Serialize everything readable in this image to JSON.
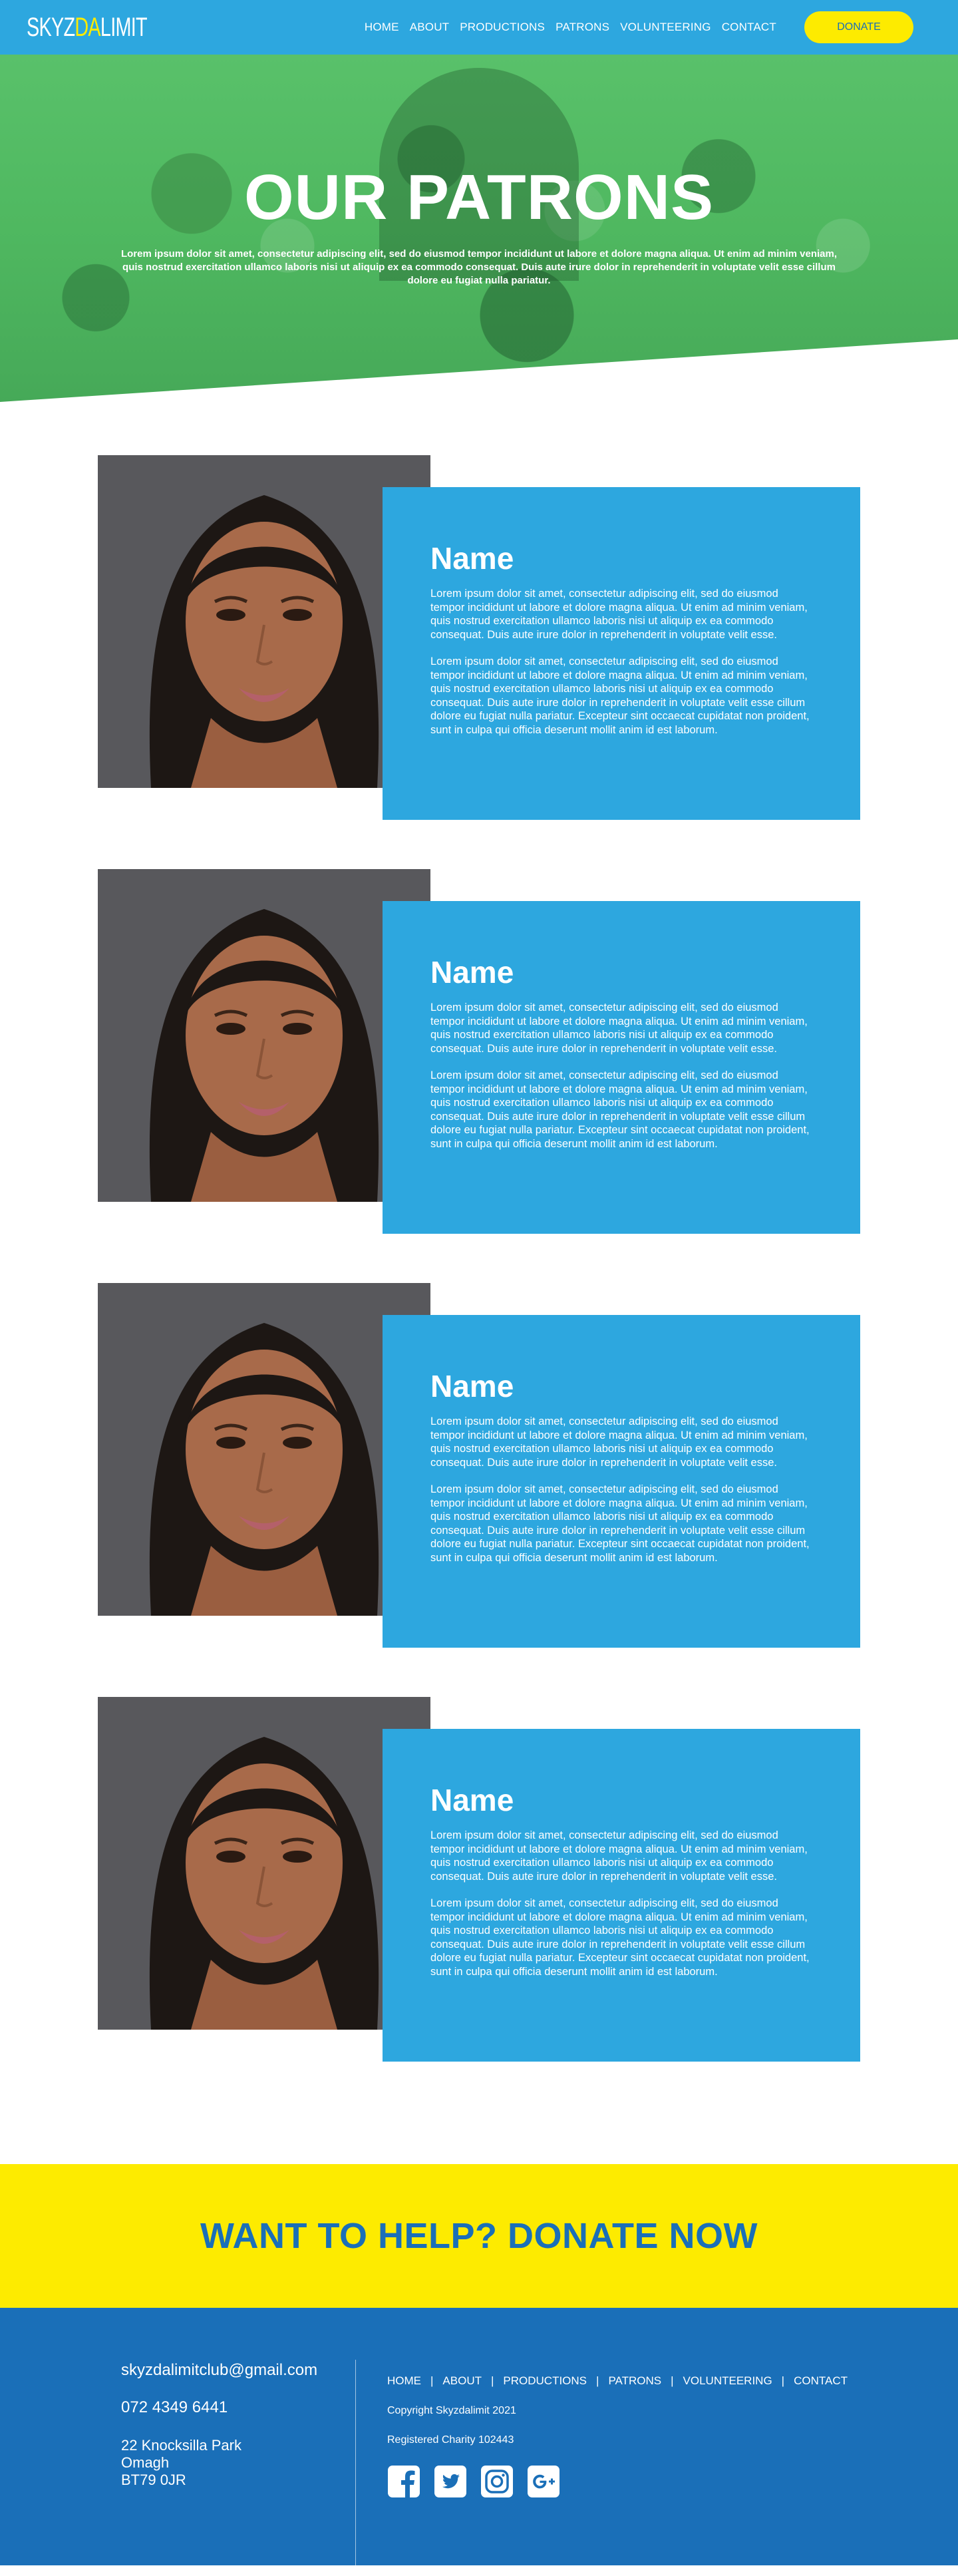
{
  "brand": {
    "logo_white": "SKYZ",
    "logo_yellow": "DA",
    "logo_white2": "LIMIT"
  },
  "nav": {
    "links": [
      "HOME",
      "ABOUT",
      "PRODUCTIONS",
      "PATRONS",
      "VOLUNTEERING",
      "CONTACT"
    ],
    "donate_label": "DONATE"
  },
  "hero": {
    "title": "OUR PATRONS",
    "text": "Lorem ipsum dolor sit amet, consectetur adipiscing elit, sed do eiusmod tempor incididunt ut labore et dolore magna aliqua. Ut enim ad minim veniam, quis nostrud exercitation ullamco laboris nisi ut aliquip ex ea commodo consequat. Duis aute irure dolor in reprehenderit in voluptate velit esse cillum dolore eu fugiat nulla pariatur."
  },
  "patrons": [
    {
      "name": "Name",
      "p1": "Lorem ipsum dolor sit amet, consectetur adipiscing elit, sed do eiusmod tempor incididunt ut labore et dolore magna aliqua. Ut enim ad minim veniam, quis nostrud exercitation ullamco laboris nisi ut aliquip ex ea commodo consequat. Duis aute irure dolor in reprehenderit in voluptate velit esse.",
      "p2": "Lorem ipsum dolor sit amet, consectetur adipiscing elit, sed do eiusmod tempor incididunt ut labore et dolore magna aliqua. Ut enim ad minim veniam, quis nostrud exercitation ullamco laboris nisi ut aliquip ex ea commodo consequat. Duis aute irure dolor in reprehenderit in voluptate velit esse cillum dolore eu fugiat nulla pariatur. Excepteur sint occaecat cupidatat non proident, sunt in culpa qui officia deserunt mollit anim id est laborum."
    },
    {
      "name": "Name",
      "p1": "Lorem ipsum dolor sit amet, consectetur adipiscing elit, sed do eiusmod tempor incididunt ut labore et dolore magna aliqua. Ut enim ad minim veniam, quis nostrud exercitation ullamco laboris nisi ut aliquip ex ea commodo consequat. Duis aute irure dolor in reprehenderit in voluptate velit esse.",
      "p2": "Lorem ipsum dolor sit amet, consectetur adipiscing elit, sed do eiusmod tempor incididunt ut labore et dolore magna aliqua. Ut enim ad minim veniam, quis nostrud exercitation ullamco laboris nisi ut aliquip ex ea commodo consequat. Duis aute irure dolor in reprehenderit in voluptate velit esse cillum dolore eu fugiat nulla pariatur. Excepteur sint occaecat cupidatat non proident, sunt in culpa qui officia deserunt mollit anim id est laborum."
    },
    {
      "name": "Name",
      "p1": "Lorem ipsum dolor sit amet, consectetur adipiscing elit, sed do eiusmod tempor incididunt ut labore et dolore magna aliqua. Ut enim ad minim veniam, quis nostrud exercitation ullamco laboris nisi ut aliquip ex ea commodo consequat. Duis aute irure dolor in reprehenderit in voluptate velit esse.",
      "p2": "Lorem ipsum dolor sit amet, consectetur adipiscing elit, sed do eiusmod tempor incididunt ut labore et dolore magna aliqua. Ut enim ad minim veniam, quis nostrud exercitation ullamco laboris nisi ut aliquip ex ea commodo consequat. Duis aute irure dolor in reprehenderit in voluptate velit esse cillum dolore eu fugiat nulla pariatur. Excepteur sint occaecat cupidatat non proident, sunt in culpa qui officia deserunt mollit anim id est laborum."
    },
    {
      "name": "Name",
      "p1": "Lorem ipsum dolor sit amet, consectetur adipiscing elit, sed do eiusmod tempor incididunt ut labore et dolore magna aliqua. Ut enim ad minim veniam, quis nostrud exercitation ullamco laboris nisi ut aliquip ex ea commodo consequat. Duis aute irure dolor in reprehenderit in voluptate velit esse.",
      "p2": "Lorem ipsum dolor sit amet, consectetur adipiscing elit, sed do eiusmod tempor incididunt ut labore et dolore magna aliqua. Ut enim ad minim veniam, quis nostrud exercitation ullamco laboris nisi ut aliquip ex ea commodo consequat. Duis aute irure dolor in reprehenderit in voluptate velit esse cillum dolore eu fugiat nulla pariatur. Excepteur sint occaecat cupidatat non proident, sunt in culpa qui officia deserunt mollit anim id est laborum."
    }
  ],
  "donate_banner": {
    "title": "WANT TO HELP? DONATE NOW"
  },
  "footer": {
    "email": "skyzdalimitclub@gmail.com",
    "phone": "072 4349 6441",
    "address": [
      "22 Knocksilla Park",
      "Omagh",
      "BT79 0JR"
    ],
    "links": [
      "HOME",
      "ABOUT",
      "PRODUCTIONS",
      "PATRONS",
      "VOLUNTEERING",
      "CONTACT"
    ],
    "separator": "|",
    "copyright": "Copyright Skyzdalimit 2021",
    "charity": "Registered Charity 102443",
    "socials": [
      "facebook-icon",
      "twitter-icon",
      "instagram-icon",
      "google-plus-icon"
    ]
  },
  "colors": {
    "primary_blue": "#2da7df",
    "dark_blue": "#1a6fb8",
    "yellow": "#fdeb00",
    "hero_green": "#4fb860"
  }
}
